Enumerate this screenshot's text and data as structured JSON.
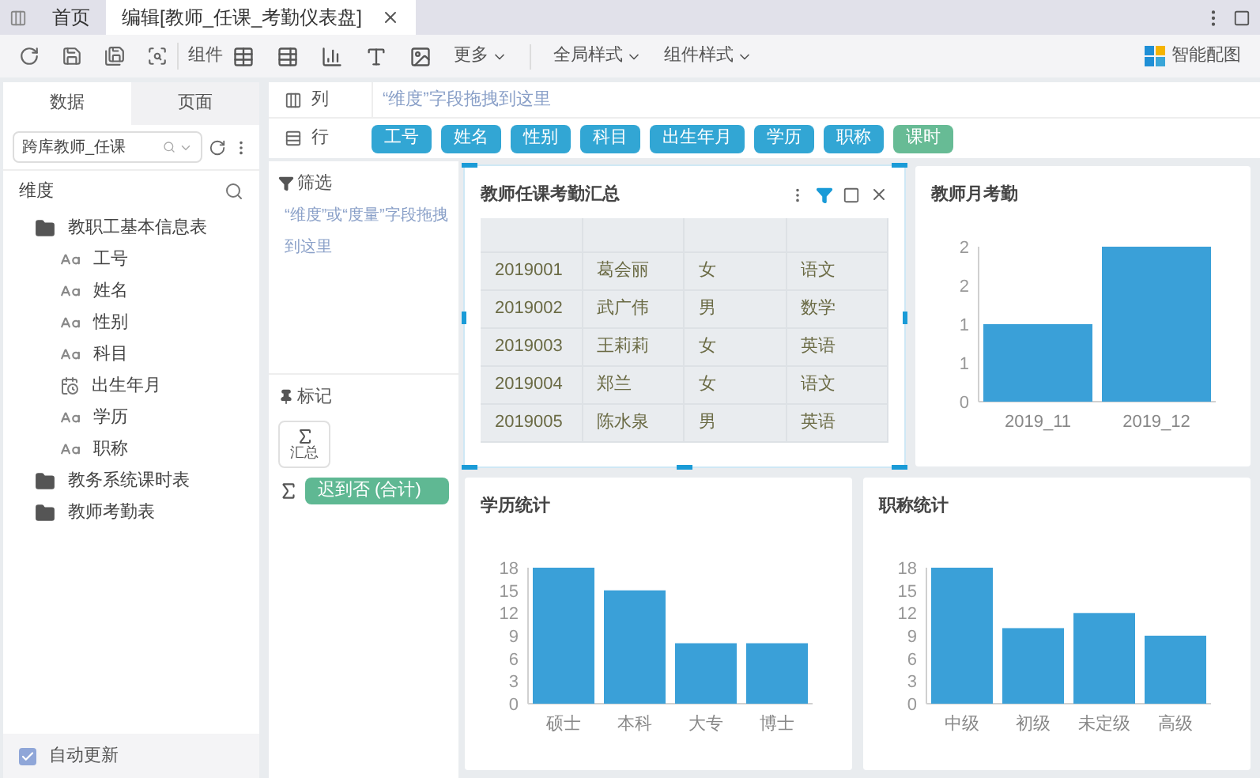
{
  "tabs": [
    {
      "label": "首页",
      "selected": false,
      "closable": false
    },
    {
      "label": "编辑[教师_任课_考勤仪表盘]",
      "selected": true,
      "closable": true
    }
  ],
  "toolbar": {
    "component_label": "组件",
    "more": "更多",
    "global_style": "全局样式",
    "component_style": "组件样式",
    "smart_chart": "智能配图"
  },
  "left_panel": {
    "tabs": [
      {
        "label": "数据",
        "selected": true
      },
      {
        "label": "页面",
        "selected": false
      }
    ],
    "dataset": {
      "value": "跨库教师_任课"
    },
    "section": "维度",
    "tree": [
      {
        "label": "教职工基本信息表",
        "kind": "folder",
        "children": [
          {
            "label": "工号",
            "kind": "text"
          },
          {
            "label": "姓名",
            "kind": "text"
          },
          {
            "label": "性别",
            "kind": "text"
          },
          {
            "label": "科目",
            "kind": "text"
          },
          {
            "label": "出生年月",
            "kind": "date"
          },
          {
            "label": "学历",
            "kind": "text"
          },
          {
            "label": "职称",
            "kind": "text"
          }
        ]
      },
      {
        "label": "教务系统课时表",
        "kind": "folder"
      },
      {
        "label": "教师考勤表",
        "kind": "folder"
      }
    ],
    "auto_update": {
      "label": "自动更新",
      "checked": true
    }
  },
  "shelves": {
    "columns": {
      "label": "列",
      "hint": "“维度”字段拖拽到这里"
    },
    "rows": {
      "label": "行",
      "fields": [
        {
          "label": "工号",
          "color": "#32a6d4"
        },
        {
          "label": "姓名",
          "color": "#32a6d4"
        },
        {
          "label": "性别",
          "color": "#32a6d4"
        },
        {
          "label": "科目",
          "color": "#32a6d4"
        },
        {
          "label": "出生年月",
          "color": "#32a6d4"
        },
        {
          "label": "学历",
          "color": "#32a6d4"
        },
        {
          "label": "职称",
          "color": "#32a6d4"
        },
        {
          "label": "课时",
          "color": "#67bb95"
        }
      ]
    }
  },
  "filter": {
    "title": "筛选",
    "hint": "“维度”或“度量”字段拖拽到这里"
  },
  "marks": {
    "title": "标记",
    "summary_button": "汇总",
    "measure": {
      "label": "迟到否 (合计)",
      "color": "#5fb893"
    }
  },
  "table_card": {
    "title": "教师任课考勤汇总",
    "selected": true,
    "rows": [
      [
        "2019001",
        "葛会丽",
        "女",
        "语文"
      ],
      [
        "2019002",
        "武广伟",
        "男",
        "数学"
      ],
      [
        "2019003",
        "王莉莉",
        "女",
        "英语"
      ],
      [
        "2019004",
        "郑兰",
        "女",
        "语文"
      ],
      [
        "2019005",
        "陈水泉",
        "男",
        "英语"
      ]
    ]
  },
  "chart_cards": [
    {
      "title": "教师月考勤",
      "chart_data": {
        "type": "bar",
        "categories": [
          "2019_11",
          "2019_12"
        ],
        "series": [
          {
            "color": "#3aa0d8",
            "values": [
              1,
              2
            ]
          }
        ],
        "ylim": [
          0,
          2
        ],
        "yticks": [
          0,
          {
            "value": 0.5,
            "label": "1"
          },
          1,
          {
            "value": 1.5,
            "label": "2"
          },
          2
        ]
      }
    },
    {
      "title": "学历统计",
      "chart_data": {
        "type": "bar",
        "categories": [
          "硕士",
          "本科",
          "大专",
          "博士"
        ],
        "series": [
          {
            "color": "#3aa0d8",
            "values": [
              18,
              15,
              8,
              8
            ]
          }
        ],
        "ylim": [
          0,
          18
        ],
        "yticks": [
          0,
          3,
          6,
          9,
          12,
          15,
          18
        ]
      }
    },
    {
      "title": "职称统计",
      "chart_data": {
        "type": "bar",
        "categories": [
          "中级",
          "初级",
          "未定级",
          "高级"
        ],
        "series": [
          {
            "color": "#3aa0d8",
            "values": [
              18,
              10,
              12,
              9
            ]
          }
        ],
        "ylim": [
          0,
          18
        ],
        "yticks": [
          0,
          3,
          6,
          9,
          12,
          15,
          18
        ]
      }
    }
  ]
}
